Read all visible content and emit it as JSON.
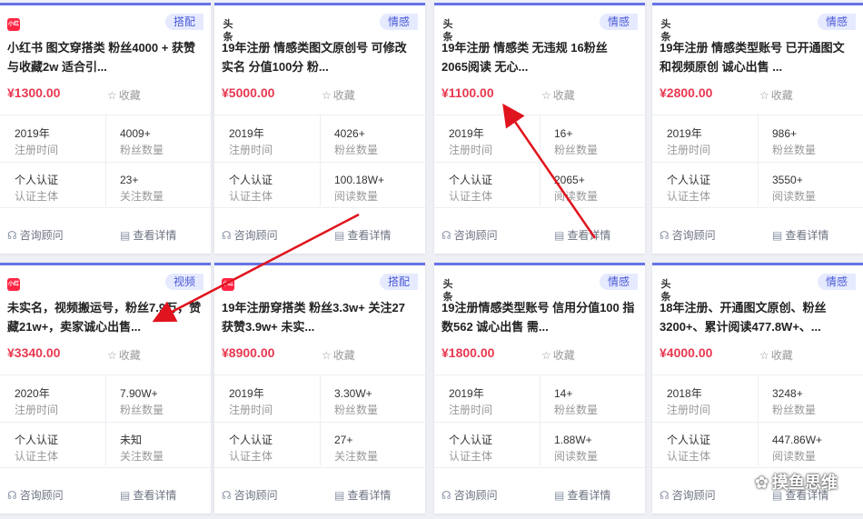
{
  "common": {
    "fav_label": "收藏",
    "consult_label": "咨询顾问",
    "detail_label": "查看详情",
    "reg_time_label": "注册时间",
    "auth_label": "认证主体"
  },
  "cards": [
    {
      "tag": "搭配",
      "platform": "xhs",
      "platform_text": "小红书",
      "title": "小红书 图文穿搭类 粉丝4000 + 获赞与收藏2w 适合引...",
      "price": "¥1300.00",
      "year": "2019年",
      "s1v": "4009+",
      "s1l": "粉丝数量",
      "auth": "个人认证",
      "s2v": "23+",
      "s2l": "关注数量"
    },
    {
      "tag": "情感",
      "platform": "tt",
      "platform_text": "头条",
      "title": "19年注册 情感类图文原创号 可修改实名 分值100分 粉...",
      "price": "¥5000.00",
      "year": "2019年",
      "s1v": "4026+",
      "s1l": "粉丝数量",
      "auth": "个人认证",
      "s2v": "100.18W+",
      "s2l": "阅读数量"
    },
    {
      "tag": "情感",
      "platform": "tt",
      "platform_text": "头条",
      "title": "19年注册 情感类 无违规 16粉丝 2065阅读 无心...",
      "price": "¥1100.00",
      "year": "2019年",
      "s1v": "16+",
      "s1l": "粉丝数量",
      "auth": "个人认证",
      "s2v": "2065+",
      "s2l": "阅读数量"
    },
    {
      "tag": "情感",
      "platform": "tt",
      "platform_text": "头条",
      "title": "19年注册 情感类型账号 已开通图文和视频原创 诚心出售 ...",
      "price": "¥2800.00",
      "year": "2019年",
      "s1v": "986+",
      "s1l": "粉丝数量",
      "auth": "个人认证",
      "s2v": "3550+",
      "s2l": "阅读数量"
    },
    {
      "tag": "视频",
      "platform": "xhs",
      "platform_text": "小红书",
      "title": "未实名，视频搬运号，粉丝7.9万，赞藏21w+，卖家诚心出售...",
      "price": "¥3340.00",
      "year": "2020年",
      "s1v": "7.90W+",
      "s1l": "粉丝数量",
      "auth": "个人认证",
      "s2v": "未知",
      "s2l": "关注数量"
    },
    {
      "tag": "搭配",
      "platform": "xhs",
      "platform_text": "小红书",
      "title": "19年注册穿搭类 粉丝3.3w+ 关注27 获赞3.9w+ 未实...",
      "price": "¥8900.00",
      "year": "2019年",
      "s1v": "3.30W+",
      "s1l": "粉丝数量",
      "auth": "个人认证",
      "s2v": "27+",
      "s2l": "关注数量"
    },
    {
      "tag": "情感",
      "platform": "tt",
      "platform_text": "头条",
      "title": "19注册情感类型账号 信用分值100 指数562 诚心出售 需...",
      "price": "¥1800.00",
      "year": "2019年",
      "s1v": "14+",
      "s1l": "粉丝数量",
      "auth": "个人认证",
      "s2v": "1.88W+",
      "s2l": "阅读数量"
    },
    {
      "tag": "情感",
      "platform": "tt",
      "platform_text": "头条",
      "title": "18年注册、开通图文原创、粉丝3200+、累计阅读477.8W+、...",
      "price": "¥4000.00",
      "year": "2018年",
      "s1v": "3248+",
      "s1l": "粉丝数量",
      "auth": "个人认证",
      "s2v": "447.86W+",
      "s2l": "阅读数量"
    }
  ],
  "watermark": "摸鱼思维",
  "colors": {
    "accent": "#6673e6",
    "price": "#e8384f",
    "tag_bg": "#e6eaff",
    "arrow": "#e0141e"
  }
}
